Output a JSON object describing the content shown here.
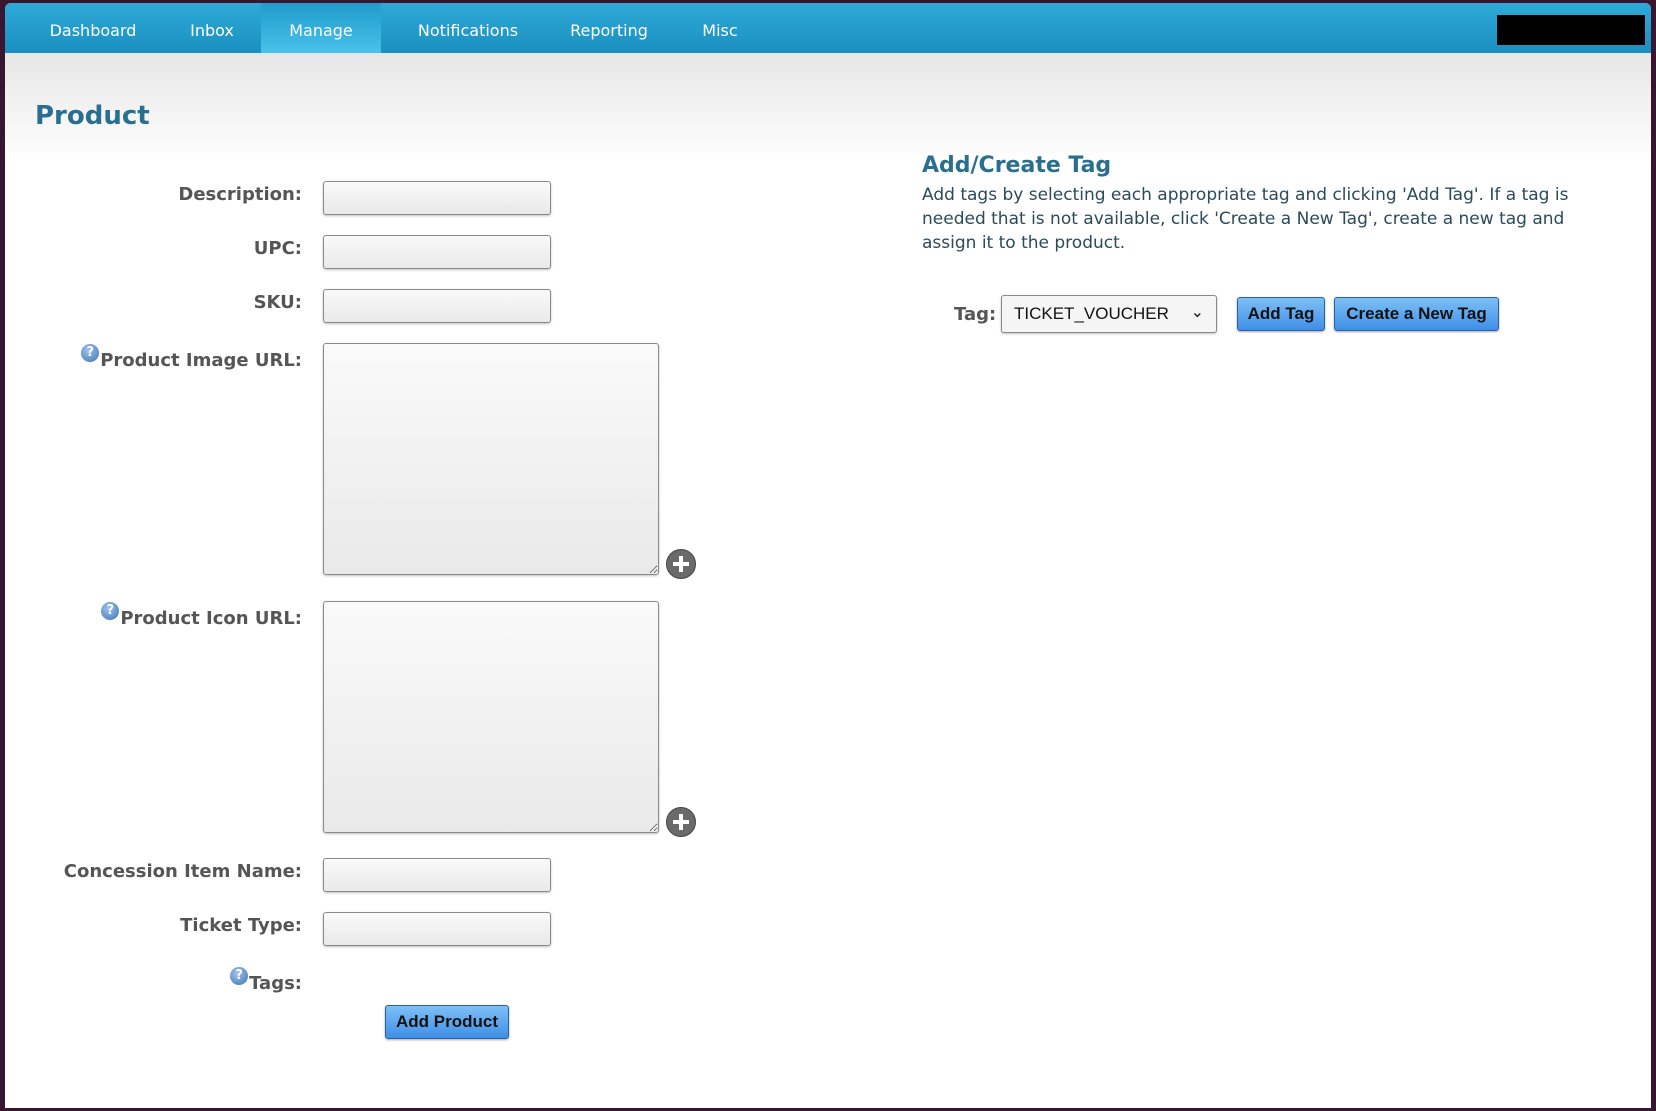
{
  "nav": {
    "items": [
      {
        "label": "Dashboard"
      },
      {
        "label": "Inbox"
      },
      {
        "label": "Manage"
      },
      {
        "label": "Notifications"
      },
      {
        "label": "Reporting"
      },
      {
        "label": "Misc"
      }
    ],
    "active": "Manage"
  },
  "page": {
    "title": "Product"
  },
  "form": {
    "description_label": "Description:",
    "upc_label": "UPC:",
    "sku_label": "SKU:",
    "image_url_label": "Product Image URL:",
    "icon_url_label": "Product Icon URL:",
    "concession_label": "Concession Item Name:",
    "ticket_type_label": "Ticket Type:",
    "tags_label": "Tags:",
    "help_glyph": "?",
    "add_product_button": "Add Product"
  },
  "tag_panel": {
    "title": "Add/Create Tag",
    "description": "Add tags by selecting each appropriate tag and clicking 'Add Tag'. If a tag is needed that is not available, click 'Create a New Tag', create a new tag and assign it to the product.",
    "tag_label": "Tag:",
    "selected_tag": "TICKET_VOUCHER",
    "add_tag_button": "Add Tag",
    "create_tag_button": "Create a New Tag"
  },
  "colors": {
    "nav_bar": "#1a8fc0",
    "accent_title": "#2a6f8f",
    "button": "#3f8fe8"
  },
  "icons": [
    "help-icon",
    "plus-circle-icon",
    "chevron-down-icon"
  ]
}
